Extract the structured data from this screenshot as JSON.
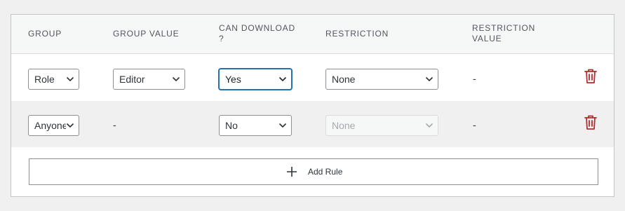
{
  "table": {
    "headers": {
      "group": "GROUP",
      "group_value": "GROUP VALUE",
      "can_download": "CAN DOWNLOAD ?",
      "restriction": "RESTRICTION",
      "restriction_value": "RESTRICTION VALUE"
    },
    "rows": [
      {
        "group": "Role",
        "group_value": "Editor",
        "can_download": "Yes",
        "restriction": "None",
        "restriction_value": "-"
      },
      {
        "group": "Anyone",
        "group_value": "-",
        "can_download": "No",
        "restriction": "None",
        "restriction_value": "-"
      }
    ]
  },
  "add_rule": {
    "label": "Add Rule",
    "icon": "plus-icon"
  },
  "icons": {
    "delete": "trash-icon",
    "dropdown": "chevron-down-icon"
  },
  "colors": {
    "delete_icon": "#b32d2e",
    "focus_border": "#2271b1",
    "row_alt_background": "#f0f0f1",
    "header_background": "#f6f7f7"
  }
}
